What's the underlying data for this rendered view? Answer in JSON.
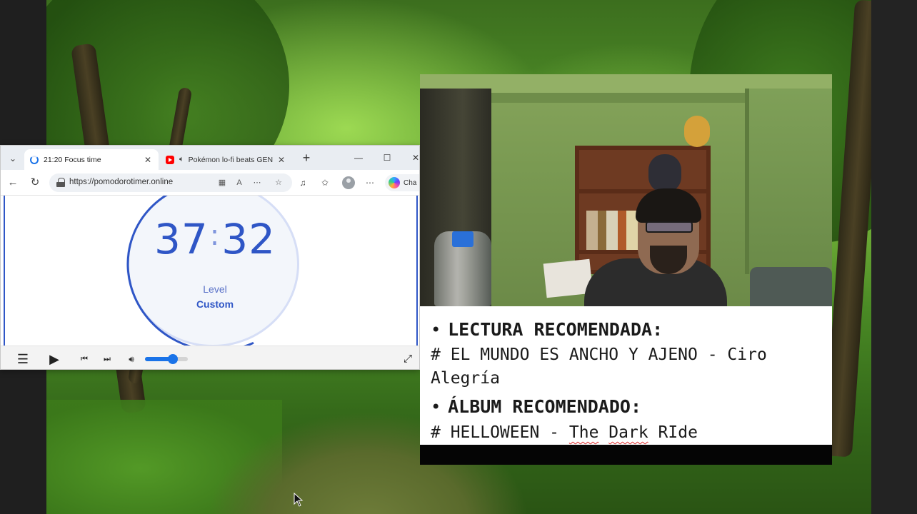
{
  "browser": {
    "tabs": [
      {
        "title": "21:20 Focus time",
        "active": true,
        "icon": "loading-spinner-icon"
      },
      {
        "title": "Pokémon lo-fi beats GEN",
        "active": false,
        "icon": "youtube-icon",
        "muted": false
      }
    ],
    "url": "https://pomodorotimer.online",
    "copilot_label": "Cha"
  },
  "timer": {
    "minutes": "37",
    "separator": ":",
    "seconds": "32",
    "level_label": "Level",
    "level_value": "Custom",
    "accent": "#2f56c6"
  },
  "player": {
    "volume": 0.65
  },
  "notes": {
    "bullet": "•",
    "heading1": "LECTURA RECOMENDADA:",
    "line1a": "# EL MUNDO ES ANCHO Y AJENO - Ciro",
    "line1b": "Alegría",
    "heading2": "ÁLBUM RECOMENDADO:",
    "line2_prefix": "# HELLOWEEN - ",
    "line2_w1": "The",
    "line2_w2": "Dark",
    "line2_w3": "RIde"
  }
}
